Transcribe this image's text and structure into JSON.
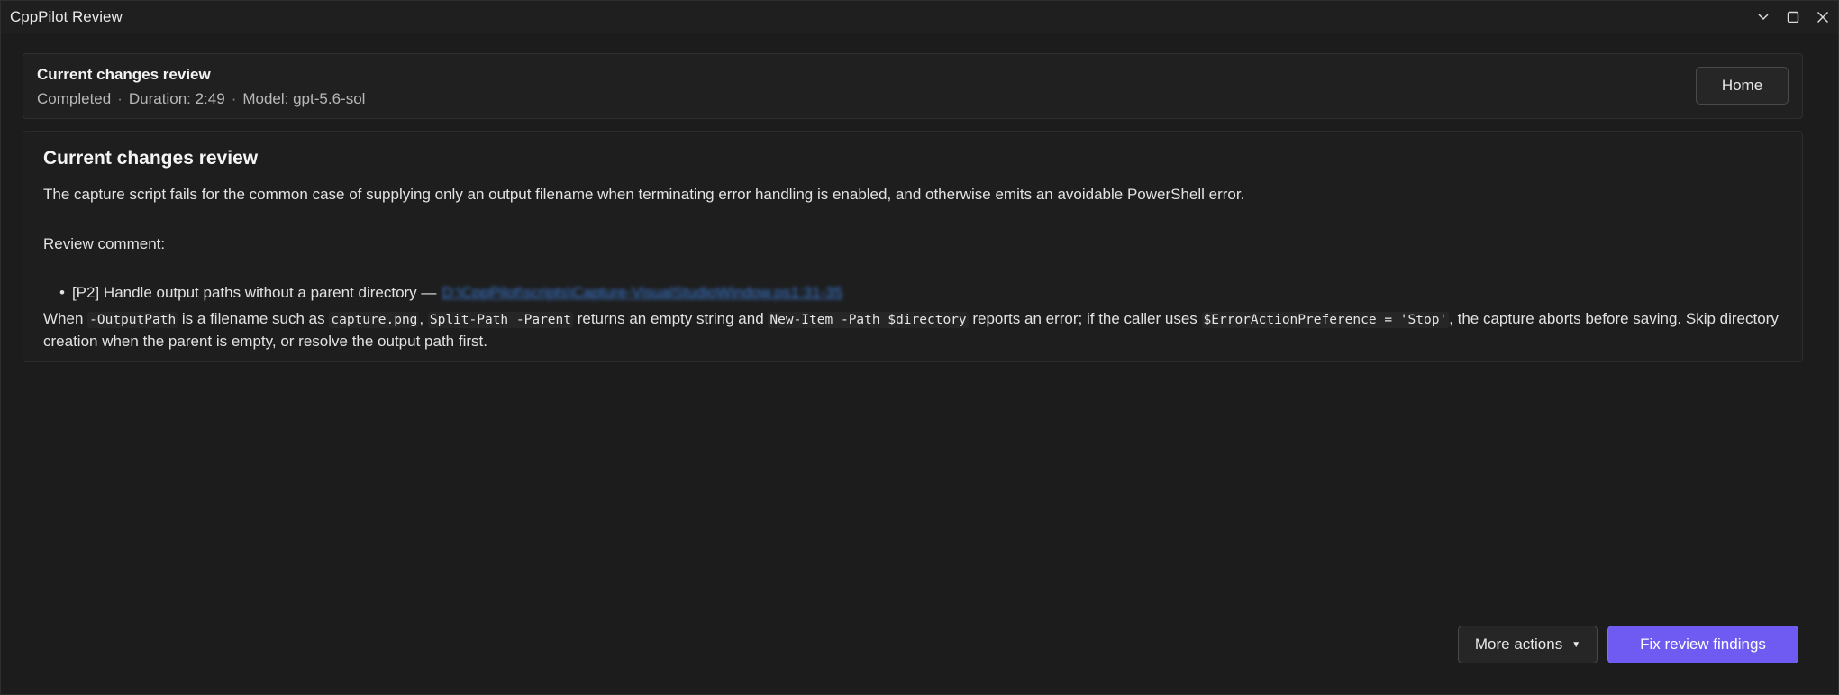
{
  "window": {
    "title": "CppPilot Review"
  },
  "header": {
    "title": "Current changes review",
    "status": "Completed",
    "duration": "Duration: 2:49",
    "model": "Model: gpt-5.6-sol",
    "separator": "·",
    "home_label": "Home"
  },
  "review": {
    "title": "Current changes review",
    "summary": "The capture script fails for the common case of supplying only an output filename when terminating error handling is enabled, and otherwise emits an avoidable PowerShell error.",
    "comment_label": "Review comment:",
    "finding": {
      "bullet": "•",
      "text": "[P2] Handle output paths without a parent directory —",
      "link": "D:\\CppPilot\\scripts\\Capture-VisualStudioWindow.ps1:31-35"
    },
    "detail": {
      "t1": "When ",
      "c1": "-OutputPath",
      "t2": " is a filename such as ",
      "c2": "capture.png",
      "t3": ", ",
      "c3": "Split-Path -Parent",
      "t4": " returns an empty string and ",
      "c4": "New-Item -Path $directory",
      "t5": " reports an error; if the caller uses ",
      "c5": "$ErrorActionPreference = 'Stop'",
      "t6": ", the capture aborts before saving. Skip directory creation when the parent is empty, or resolve the output path first."
    }
  },
  "actions": {
    "more_label": "More actions",
    "more_caret": "▼",
    "fix_label": "Fix review findings"
  },
  "colors": {
    "background": "#1c1c1c",
    "accent": "#6f5bf2",
    "link": "#3b7bd6"
  }
}
